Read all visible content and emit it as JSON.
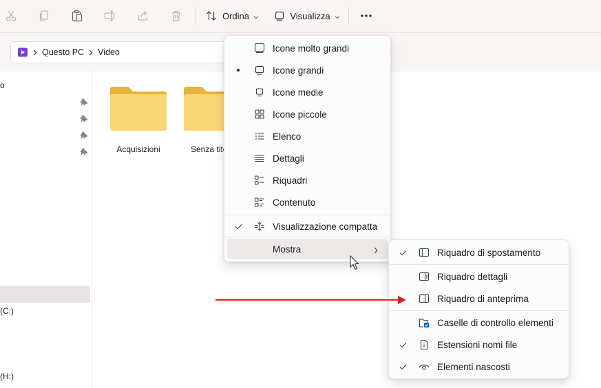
{
  "toolbar": {
    "sort_label": "Ordina",
    "view_label": "Visualizza",
    "icons": [
      "scissors-icon",
      "copy-icon",
      "paste-icon",
      "rename-icon",
      "share-icon",
      "delete-icon",
      "sort-icon",
      "view-icon",
      "more-icon"
    ]
  },
  "address": {
    "crumbs": [
      "Questo PC",
      "Video"
    ],
    "icon": "videos-folder-icon"
  },
  "sidebar": {
    "partial_top": "o",
    "drive_c": "(C:)",
    "drive_h": "(H:)"
  },
  "folders": [
    {
      "label": "Acquisizioni"
    },
    {
      "label": "Senza tito"
    }
  ],
  "view_menu": {
    "items": [
      {
        "label": "Icone molto grandi",
        "icon": "extra-large-icons-icon",
        "selected": false
      },
      {
        "label": "Icone grandi",
        "icon": "large-icons-icon",
        "selected": true
      },
      {
        "label": "Icone medie",
        "icon": "medium-icons-icon",
        "selected": false
      },
      {
        "label": "Icone piccole",
        "icon": "small-icons-icon",
        "selected": false
      },
      {
        "label": "Elenco",
        "icon": "list-icon",
        "selected": false
      },
      {
        "label": "Dettagli",
        "icon": "details-icon",
        "selected": false
      },
      {
        "label": "Riquadri",
        "icon": "tiles-icon",
        "selected": false
      },
      {
        "label": "Contenuto",
        "icon": "content-icon",
        "selected": false
      }
    ],
    "compact": {
      "label": "Visualizzazione compatta",
      "checked": true
    },
    "show": {
      "label": "Mostra"
    }
  },
  "show_menu": {
    "items": [
      {
        "label": "Riquadro di spostamento",
        "checked": true
      },
      {
        "label": "Riquadro dettagli",
        "checked": false
      },
      {
        "label": "Riquadro di anteprima",
        "checked": false
      },
      {
        "label": "Caselle di controllo elementi",
        "checked": false
      },
      {
        "label": "Estensioni nomi file",
        "checked": true
      },
      {
        "label": "Elementi nascosti",
        "checked": true
      }
    ]
  },
  "colors": {
    "accent": "#0067c0",
    "folder": "#f8d775",
    "annotation_arrow": "#e0211b"
  }
}
